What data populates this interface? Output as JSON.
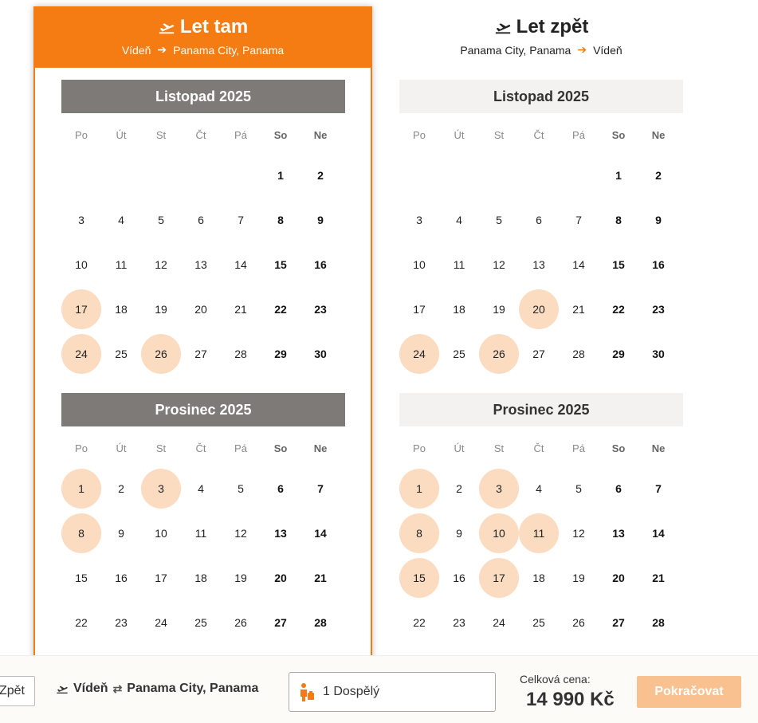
{
  "outbound": {
    "title": "Let tam",
    "from": "Vídeň",
    "arrow": "➔",
    "to": "Panama City, Panama",
    "months": [
      {
        "name": "Listopad  2025",
        "weekdays": [
          "Po",
          "Út",
          "St",
          "Čt",
          "Pá",
          "So",
          "Ne"
        ],
        "weeks": [
          [
            "",
            "",
            "",
            "",
            "",
            "1",
            "2"
          ],
          [
            "3",
            "4",
            "5",
            "6",
            "7",
            "8",
            "9"
          ],
          [
            "10",
            "11",
            "12",
            "13",
            "14",
            "15",
            "16"
          ],
          [
            "17",
            "18",
            "19",
            "20",
            "21",
            "22",
            "23"
          ],
          [
            "24",
            "25",
            "26",
            "27",
            "28",
            "29",
            "30"
          ]
        ],
        "highlighted": [
          "17",
          "24",
          "26"
        ]
      },
      {
        "name": "Prosinec  2025",
        "weekdays": [
          "Po",
          "Út",
          "St",
          "Čt",
          "Pá",
          "So",
          "Ne"
        ],
        "weeks": [
          [
            "1",
            "2",
            "3",
            "4",
            "5",
            "6",
            "7"
          ],
          [
            "8",
            "9",
            "10",
            "11",
            "12",
            "13",
            "14"
          ],
          [
            "15",
            "16",
            "17",
            "18",
            "19",
            "20",
            "21"
          ],
          [
            "22",
            "23",
            "24",
            "25",
            "26",
            "27",
            "28"
          ]
        ],
        "highlighted": [
          "1",
          "3",
          "8"
        ]
      }
    ]
  },
  "inbound": {
    "title": "Let zpět",
    "from": "Panama City, Panama",
    "arrow": "➔",
    "to": "Vídeň",
    "months": [
      {
        "name": "Listopad  2025",
        "weekdays": [
          "Po",
          "Út",
          "St",
          "Čt",
          "Pá",
          "So",
          "Ne"
        ],
        "weeks": [
          [
            "",
            "",
            "",
            "",
            "",
            "1",
            "2"
          ],
          [
            "3",
            "4",
            "5",
            "6",
            "7",
            "8",
            "9"
          ],
          [
            "10",
            "11",
            "12",
            "13",
            "14",
            "15",
            "16"
          ],
          [
            "17",
            "18",
            "19",
            "20",
            "21",
            "22",
            "23"
          ],
          [
            "24",
            "25",
            "26",
            "27",
            "28",
            "29",
            "30"
          ]
        ],
        "highlighted": [
          "20",
          "24",
          "26"
        ]
      },
      {
        "name": "Prosinec  2025",
        "weekdays": [
          "Po",
          "Út",
          "St",
          "Čt",
          "Pá",
          "So",
          "Ne"
        ],
        "weeks": [
          [
            "1",
            "2",
            "3",
            "4",
            "5",
            "6",
            "7"
          ],
          [
            "8",
            "9",
            "10",
            "11",
            "12",
            "13",
            "14"
          ],
          [
            "15",
            "16",
            "17",
            "18",
            "19",
            "20",
            "21"
          ],
          [
            "22",
            "23",
            "24",
            "25",
            "26",
            "27",
            "28"
          ]
        ],
        "highlighted": [
          "1",
          "3",
          "8",
          "10",
          "11",
          "15",
          "17"
        ]
      }
    ]
  },
  "bottom": {
    "back_label": "Zpět",
    "route_from": "Vídeň",
    "route_swap": "⇄",
    "route_to": "Panama City, Panama",
    "passengers": "1 Dospělý",
    "price_label": "Celková cena:",
    "price_value": "14 990 Kč",
    "continue_label": "Pokračovat"
  },
  "icons": {
    "title_icon": "plane-departure-icon",
    "route_icon": "plane-departure-icon",
    "passenger_icon": "traveler-luggage-icon"
  },
  "colors": {
    "accent": "#f57c12",
    "highlight": "#fcdcc1",
    "month_bar_active": "#7e7a77",
    "month_bar_inactive": "#f3f2f1",
    "continue_disabled": "#f9c18f"
  }
}
